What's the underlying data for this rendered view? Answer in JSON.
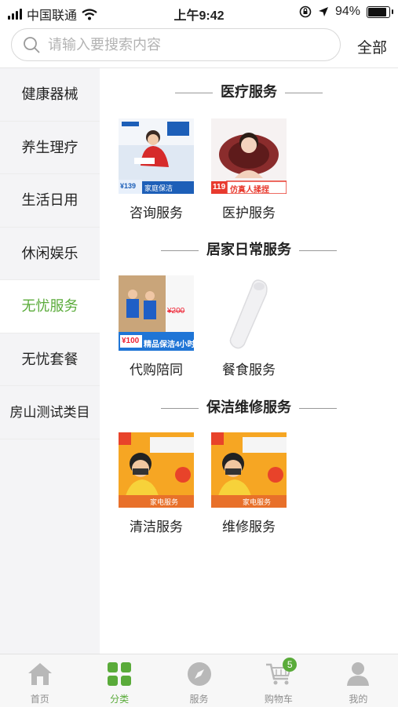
{
  "status_bar": {
    "carrier": "中国联通",
    "time": "上午9:42",
    "battery": "94%",
    "battery_level": 0.94
  },
  "search": {
    "placeholder": "请输入要搜索内容",
    "all_label": "全部"
  },
  "sidebar": {
    "active_index": 4,
    "items": [
      {
        "label": "健康器械"
      },
      {
        "label": "养生理疗"
      },
      {
        "label": "生活日用"
      },
      {
        "label": "休闲娱乐"
      },
      {
        "label": "无忧服务"
      },
      {
        "label": "无忧套餐"
      },
      {
        "label": "房山测试类目"
      }
    ]
  },
  "sections": [
    {
      "title": "医疗服务",
      "items": [
        {
          "label": "咨询服务",
          "thumb_icon": "housekeeping-photo",
          "promo_price": "¥139",
          "promo_text": "家庭保洁"
        },
        {
          "label": "医护服务",
          "thumb_icon": "massage-pillow-photo",
          "promo_price": "119",
          "promo_text": "仿真人揉捏"
        }
      ]
    },
    {
      "title": "居家日常服务",
      "items": [
        {
          "label": "代购陪同",
          "thumb_icon": "cleaning-staff-photo",
          "promo_price": "¥100",
          "promo_text": "精品保洁4小时",
          "strike_price": "¥200"
        },
        {
          "label": "餐食服务",
          "thumb_icon": "thermometer-photo"
        }
      ]
    },
    {
      "title": "保洁维修服务",
      "items": [
        {
          "label": "清洁服务",
          "thumb_icon": "ac-repair-photo",
          "promo_text": "家电服务"
        },
        {
          "label": "维修服务",
          "thumb_icon": "ac-repair-photo",
          "promo_text": "家电服务"
        }
      ]
    }
  ],
  "tabbar": {
    "active_index": 1,
    "items": [
      {
        "label": "首页",
        "icon": "home-icon"
      },
      {
        "label": "分类",
        "icon": "category-grid-icon"
      },
      {
        "label": "服务",
        "icon": "compass-icon"
      },
      {
        "label": "购物车",
        "icon": "cart-icon",
        "badge": "5"
      },
      {
        "label": "我的",
        "icon": "user-icon"
      }
    ]
  },
  "colors": {
    "accent": "#5aab3a",
    "sidebar_bg": "#f4f4f6",
    "tabbar_bg": "#f7f7f7"
  }
}
